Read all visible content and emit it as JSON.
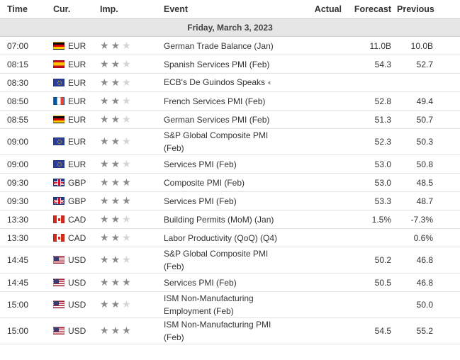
{
  "columns": {
    "time": "Time",
    "currency": "Cur.",
    "importance": "Imp.",
    "event": "Event",
    "actual": "Actual",
    "forecast": "Forecast",
    "previous": "Previous"
  },
  "date_header": "Friday, March 3, 2023",
  "flag_colors": {
    "de": "#000000",
    "es": "#c60b1e",
    "eu": "#2b3f9a",
    "fr": "#0055a4",
    "gb": "#1f3c87",
    "ca": "#d52b1e",
    "us": "#3c3b6e"
  },
  "star_icon": "star-icon",
  "speaker_icon": "speaker-icon",
  "events": [
    {
      "time": "07:00",
      "flag": "de",
      "currency": "EUR",
      "stars": 2,
      "event": "German Trade Balance (Jan)",
      "speech": false,
      "actual": "",
      "forecast": "11.0B",
      "previous": "10.0B"
    },
    {
      "time": "08:15",
      "flag": "es",
      "currency": "EUR",
      "stars": 2,
      "event": "Spanish Services PMI (Feb)",
      "speech": false,
      "actual": "",
      "forecast": "54.3",
      "previous": "52.7"
    },
    {
      "time": "08:30",
      "flag": "eu",
      "currency": "EUR",
      "stars": 2,
      "event": "ECB's De Guindos Speaks",
      "speech": true,
      "actual": "",
      "forecast": "",
      "previous": ""
    },
    {
      "time": "08:50",
      "flag": "fr",
      "currency": "EUR",
      "stars": 2,
      "event": "French Services PMI (Feb)",
      "speech": false,
      "actual": "",
      "forecast": "52.8",
      "previous": "49.4"
    },
    {
      "time": "08:55",
      "flag": "de",
      "currency": "EUR",
      "stars": 2,
      "event": "German Services PMI (Feb)",
      "speech": false,
      "actual": "",
      "forecast": "51.3",
      "previous": "50.7"
    },
    {
      "time": "09:00",
      "flag": "eu",
      "currency": "EUR",
      "stars": 2,
      "event": "S&P Global Composite PMI (Feb)",
      "speech": false,
      "actual": "",
      "forecast": "52.3",
      "previous": "50.3"
    },
    {
      "time": "09:00",
      "flag": "eu",
      "currency": "EUR",
      "stars": 2,
      "event": "Services PMI (Feb)",
      "speech": false,
      "actual": "",
      "forecast": "53.0",
      "previous": "50.8"
    },
    {
      "time": "09:30",
      "flag": "gb",
      "currency": "GBP",
      "stars": 3,
      "event": "Composite PMI (Feb)",
      "speech": false,
      "actual": "",
      "forecast": "53.0",
      "previous": "48.5"
    },
    {
      "time": "09:30",
      "flag": "gb",
      "currency": "GBP",
      "stars": 3,
      "event": "Services PMI (Feb)",
      "speech": false,
      "actual": "",
      "forecast": "53.3",
      "previous": "48.7"
    },
    {
      "time": "13:30",
      "flag": "ca",
      "currency": "CAD",
      "stars": 2,
      "event": "Building Permits (MoM) (Jan)",
      "speech": false,
      "actual": "",
      "forecast": "1.5%",
      "previous": "-7.3%"
    },
    {
      "time": "13:30",
      "flag": "ca",
      "currency": "CAD",
      "stars": 2,
      "event": "Labor Productivity (QoQ) (Q4)",
      "speech": false,
      "actual": "",
      "forecast": "",
      "previous": "0.6%"
    },
    {
      "time": "14:45",
      "flag": "us",
      "currency": "USD",
      "stars": 2,
      "event": "S&P Global Composite PMI (Feb)",
      "speech": false,
      "actual": "",
      "forecast": "50.2",
      "previous": "46.8"
    },
    {
      "time": "14:45",
      "flag": "us",
      "currency": "USD",
      "stars": 3,
      "event": "Services PMI (Feb)",
      "speech": false,
      "actual": "",
      "forecast": "50.5",
      "previous": "46.8"
    },
    {
      "time": "15:00",
      "flag": "us",
      "currency": "USD",
      "stars": 2,
      "event": "ISM Non-Manufacturing Employment (Feb)",
      "speech": false,
      "actual": "",
      "forecast": "",
      "previous": "50.0"
    },
    {
      "time": "15:00",
      "flag": "us",
      "currency": "USD",
      "stars": 3,
      "event": "ISM Non-Manufacturing PMI (Feb)",
      "speech": false,
      "actual": "",
      "forecast": "54.5",
      "previous": "55.2"
    }
  ]
}
